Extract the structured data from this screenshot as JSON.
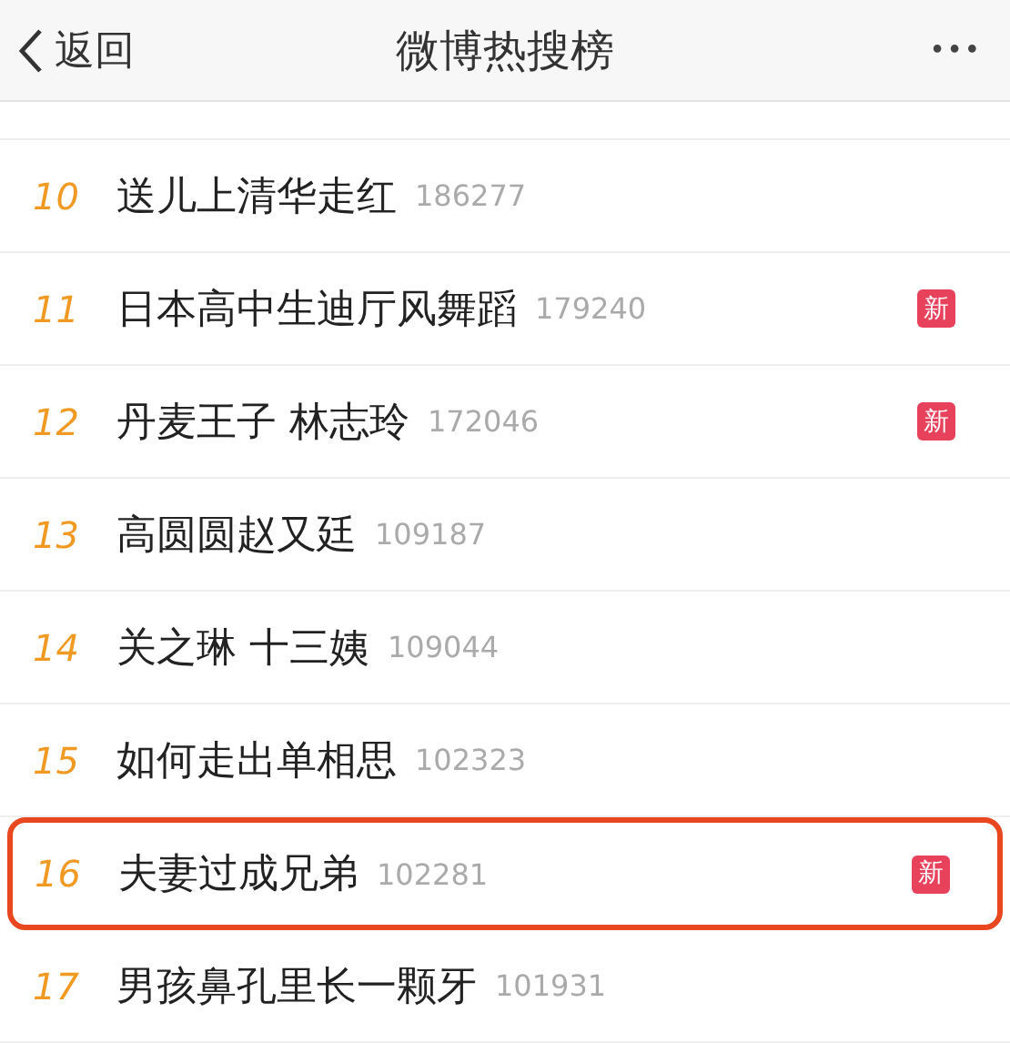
{
  "nav": {
    "back": "返回",
    "title": "微博热搜榜",
    "more": "•••"
  },
  "rows": [
    {
      "rank": "10",
      "title": "送儿上清华走红",
      "count": "186277",
      "is_new": false,
      "highlighted": false
    },
    {
      "rank": "11",
      "title": "日本高中生迪厅风舞蹈",
      "count": "179240",
      "is_new": true,
      "badge": "新",
      "highlighted": false
    },
    {
      "rank": "12",
      "title": "丹麦王子 林志玲",
      "count": "172046",
      "is_new": true,
      "badge": "新",
      "highlighted": false
    },
    {
      "rank": "13",
      "title": "高圆圆赵又廷",
      "count": "109187",
      "is_new": false,
      "highlighted": false
    },
    {
      "rank": "14",
      "title": "关之琳 十三姨",
      "count": "109044",
      "is_new": false,
      "highlighted": false
    },
    {
      "rank": "15",
      "title": "如何走出单相思",
      "count": "102323",
      "is_new": false,
      "highlighted": false
    },
    {
      "rank": "16",
      "title": "夫妻过成兄弟",
      "count": "102281",
      "is_new": true,
      "badge": "新",
      "highlighted": true
    },
    {
      "rank": "17",
      "title": "男孩鼻孔里长一颗牙",
      "count": "101931",
      "is_new": false,
      "highlighted": false
    }
  ]
}
